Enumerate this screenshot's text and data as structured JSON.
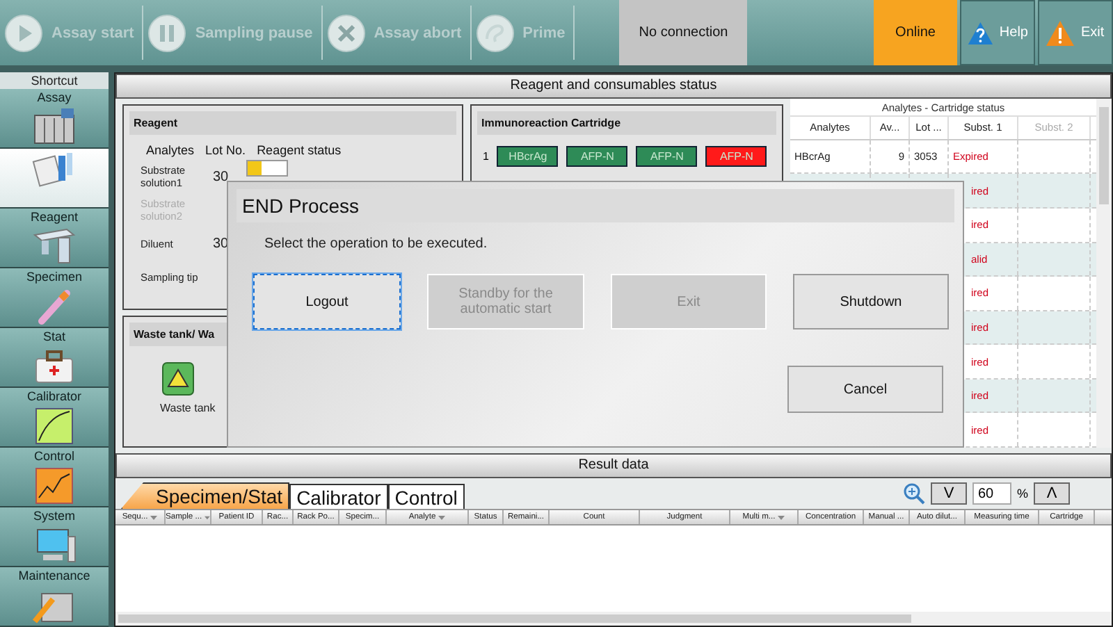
{
  "toolbar": {
    "actions": [
      {
        "label": "Assay start",
        "kind": "play",
        "disabled": true
      },
      {
        "label": "Sampling pause",
        "kind": "pause",
        "disabled": true
      },
      {
        "label": "Assay abort",
        "kind": "abort",
        "disabled": true
      },
      {
        "label": "Prime",
        "kind": "prime",
        "disabled": true
      }
    ],
    "connection": "No connection",
    "online": {
      "label": "Online",
      "on": true
    },
    "help": "Help",
    "exit": "Exit"
  },
  "sidebar": {
    "title": "Shortcut",
    "items": [
      {
        "label": "Assay",
        "kind": "analyzer",
        "selected": false
      },
      {
        "kind": "tubes",
        "selected": true
      },
      {
        "label": "Reagent",
        "kind": "reagent",
        "selected": false
      },
      {
        "label": "Specimen",
        "kind": "specimen",
        "selected": false
      },
      {
        "label": "Stat",
        "kind": "stat",
        "selected": false
      },
      {
        "label": "Calibrator",
        "kind": "calibrator",
        "selected": false
      },
      {
        "label": "Control",
        "kind": "control",
        "selected": false
      },
      {
        "label": "System",
        "kind": "system",
        "selected": false
      },
      {
        "label": "Maintenance",
        "kind": "maintenance",
        "selected": false
      }
    ]
  },
  "consumables": {
    "title": "Reagent and consumables status",
    "reagent": {
      "title": "Reagent",
      "columns": [
        "Analytes",
        "Lot No.",
        "Reagent status"
      ],
      "rows": [
        {
          "name": "Substrate solution1",
          "lot": "30",
          "level": 0.35,
          "disabled": false
        },
        {
          "name": "Substrate solution2",
          "disabled": true
        },
        {
          "name": "Diluent",
          "lot": "30",
          "disabled": false
        },
        {
          "name": "Sampling tip",
          "disabled": false
        }
      ]
    },
    "waste": {
      "title": "Waste tank/ Wa",
      "label": "Waste tank"
    },
    "cartridge": {
      "title": "Immunoreaction Cartridge",
      "rows": [
        {
          "number": "1",
          "slots": [
            {
              "label": "HBcrAg",
              "color": "#2e8b57"
            },
            {
              "label": "AFP-N",
              "color": "#2e8b57"
            },
            {
              "label": "AFP-N",
              "color": "#2e8b57"
            },
            {
              "label": "AFP-N",
              "color": "#ff1a1a"
            }
          ]
        }
      ]
    },
    "analytes_table": {
      "title": "Analytes - Cartridge status",
      "columns": [
        {
          "label": "Analytes",
          "disabled": false
        },
        {
          "label": "Av...",
          "disabled": false
        },
        {
          "label": "Lot ...",
          "disabled": false
        },
        {
          "label": "Subst. 1",
          "disabled": false
        },
        {
          "label": "Subst. 2",
          "disabled": true
        }
      ],
      "rows": [
        {
          "analyte": "HBcrAg",
          "available": "9",
          "lot": "3053",
          "subst1": "Expired"
        },
        {
          "subst1": "ired"
        },
        {
          "subst1": "ired"
        },
        {
          "subst1": "alid"
        },
        {
          "subst1": "ired"
        },
        {
          "subst1": "ired"
        },
        {
          "subst1": "ired"
        },
        {
          "subst1": "ired"
        },
        {
          "subst1": "ired"
        }
      ]
    }
  },
  "results": {
    "title": "Result data",
    "tabs": [
      {
        "label": "Specimen/Stat",
        "selected": true
      },
      {
        "label": "Calibrator",
        "selected": false
      },
      {
        "label": "Control",
        "selected": false
      }
    ],
    "zoom": {
      "down": "V",
      "value": "60",
      "unit": "%",
      "up": "Λ"
    },
    "columns": [
      {
        "label": "Sequ...",
        "filter": true
      },
      {
        "label": "Sample ...",
        "filter": true
      },
      {
        "label": "Patient ID",
        "filter": false
      },
      {
        "label": "Rac...",
        "filter": false
      },
      {
        "label": "Rack Po...",
        "filter": false
      },
      {
        "label": "Specim...",
        "filter": false
      },
      {
        "label": "Analyte",
        "filter": true
      },
      {
        "label": "Status",
        "filter": false
      },
      {
        "label": "Remaini...",
        "filter": false
      },
      {
        "label": "Count",
        "filter": false
      },
      {
        "label": "Judgment",
        "filter": false
      },
      {
        "label": "Multi m...",
        "filter": true
      },
      {
        "label": "Concentration",
        "filter": false
      },
      {
        "label": "Manual ...",
        "filter": false
      },
      {
        "label": "Auto dilut...",
        "filter": false
      },
      {
        "label": "Measuring time",
        "filter": false
      },
      {
        "label": "Cartridge",
        "filter": false
      }
    ]
  },
  "dialog": {
    "title": "END Process",
    "message": "Select the operation to be executed.",
    "buttons": [
      {
        "label": "Logout",
        "disabled": false,
        "focused": true
      },
      {
        "label": "Standby for the automatic start",
        "disabled": true,
        "focused": false
      },
      {
        "label": "Exit",
        "disabled": true,
        "focused": false
      },
      {
        "label": "Shutdown",
        "disabled": false,
        "focused": false
      }
    ],
    "cancel": "Cancel"
  }
}
